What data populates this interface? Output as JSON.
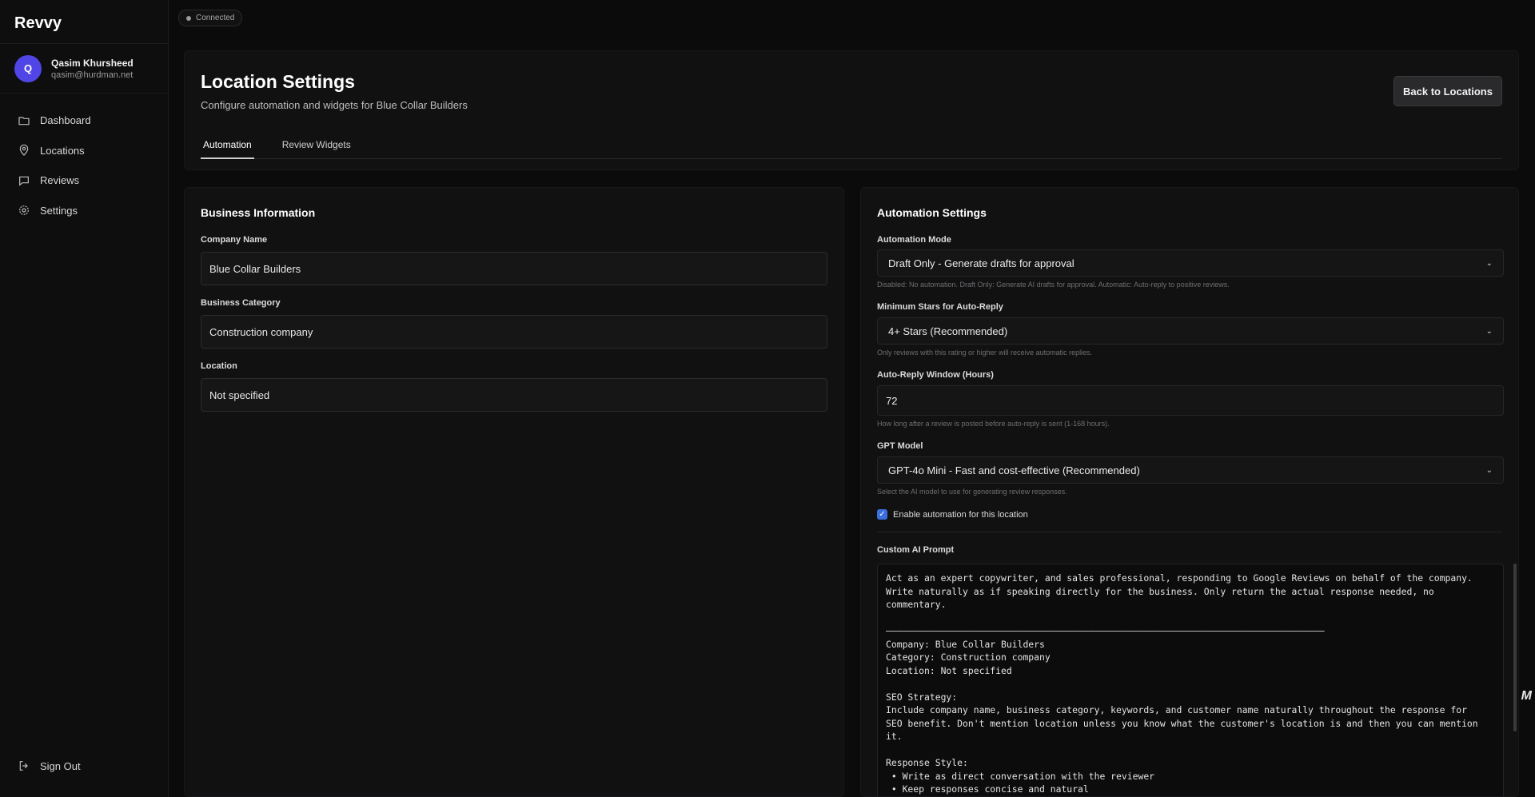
{
  "app": {
    "name": "Revvy"
  },
  "user": {
    "initial": "Q",
    "name": "Qasim Khursheed",
    "email": "qasim@hurdman.net"
  },
  "nav": {
    "items": [
      {
        "label": "Dashboard",
        "icon": "folder-icon"
      },
      {
        "label": "Locations",
        "icon": "map-pin-icon"
      },
      {
        "label": "Reviews",
        "icon": "chat-icon"
      },
      {
        "label": "Settings",
        "icon": "gear-icon"
      }
    ],
    "sign_out": "Sign Out"
  },
  "status": {
    "connection": "Connected"
  },
  "header": {
    "title": "Location Settings",
    "subtitle": "Configure automation and widgets for Blue Collar Builders",
    "back_button": "Back to Locations",
    "tabs": [
      {
        "label": "Automation",
        "active": true
      },
      {
        "label": "Review Widgets",
        "active": false
      }
    ]
  },
  "business": {
    "title": "Business Information",
    "company_name_label": "Company Name",
    "company_name_value": "Blue Collar Builders",
    "category_label": "Business Category",
    "category_value": "Construction company",
    "location_label": "Location",
    "location_value": "Not specified"
  },
  "automation": {
    "title": "Automation Settings",
    "mode_label": "Automation Mode",
    "mode_value": "Draft Only - Generate drafts for approval",
    "mode_help": "Disabled: No automation. Draft Only: Generate AI drafts for approval. Automatic: Auto-reply to positive reviews.",
    "min_stars_label": "Minimum Stars for Auto-Reply",
    "min_stars_value": "4+ Stars (Recommended)",
    "min_stars_help": "Only reviews with this rating or higher will receive automatic replies.",
    "window_label": "Auto-Reply Window (Hours)",
    "window_value": "72",
    "window_help": "How long after a review is posted before auto-reply is sent (1-168 hours).",
    "gpt_label": "GPT Model",
    "gpt_value": "GPT-4o Mini - Fast and cost-effective (Recommended)",
    "gpt_help": "Select the AI model to use for generating review responses.",
    "enable_label": "Enable automation for this location",
    "enable_checked": true,
    "prompt_label": "Custom AI Prompt",
    "prompt_text": "Act as an expert copywriter, and sales professional, responding to Google Reviews on behalf of the company.\nWrite naturally as if speaking directly for the business. Only return the actual response needed, no\ncommentary.\n\n————————————————————————————————————————————————————————————————————————————————\nCompany: Blue Collar Builders\nCategory: Construction company\nLocation: Not specified\n\nSEO Strategy:\nInclude company name, business category, keywords, and customer name naturally throughout the response for\nSEO benefit. Don't mention location unless you know what the customer's location is and then you can mention\nit.\n\nResponse Style:\n • Write as direct conversation with the reviewer\n • Keep responses concise and natural"
  },
  "floating": {
    "logo": "M"
  },
  "colors": {
    "accent": "#4f46e5",
    "checkbox": "#3b6fe0",
    "background": "#0b0b0c",
    "card": "#111112"
  }
}
